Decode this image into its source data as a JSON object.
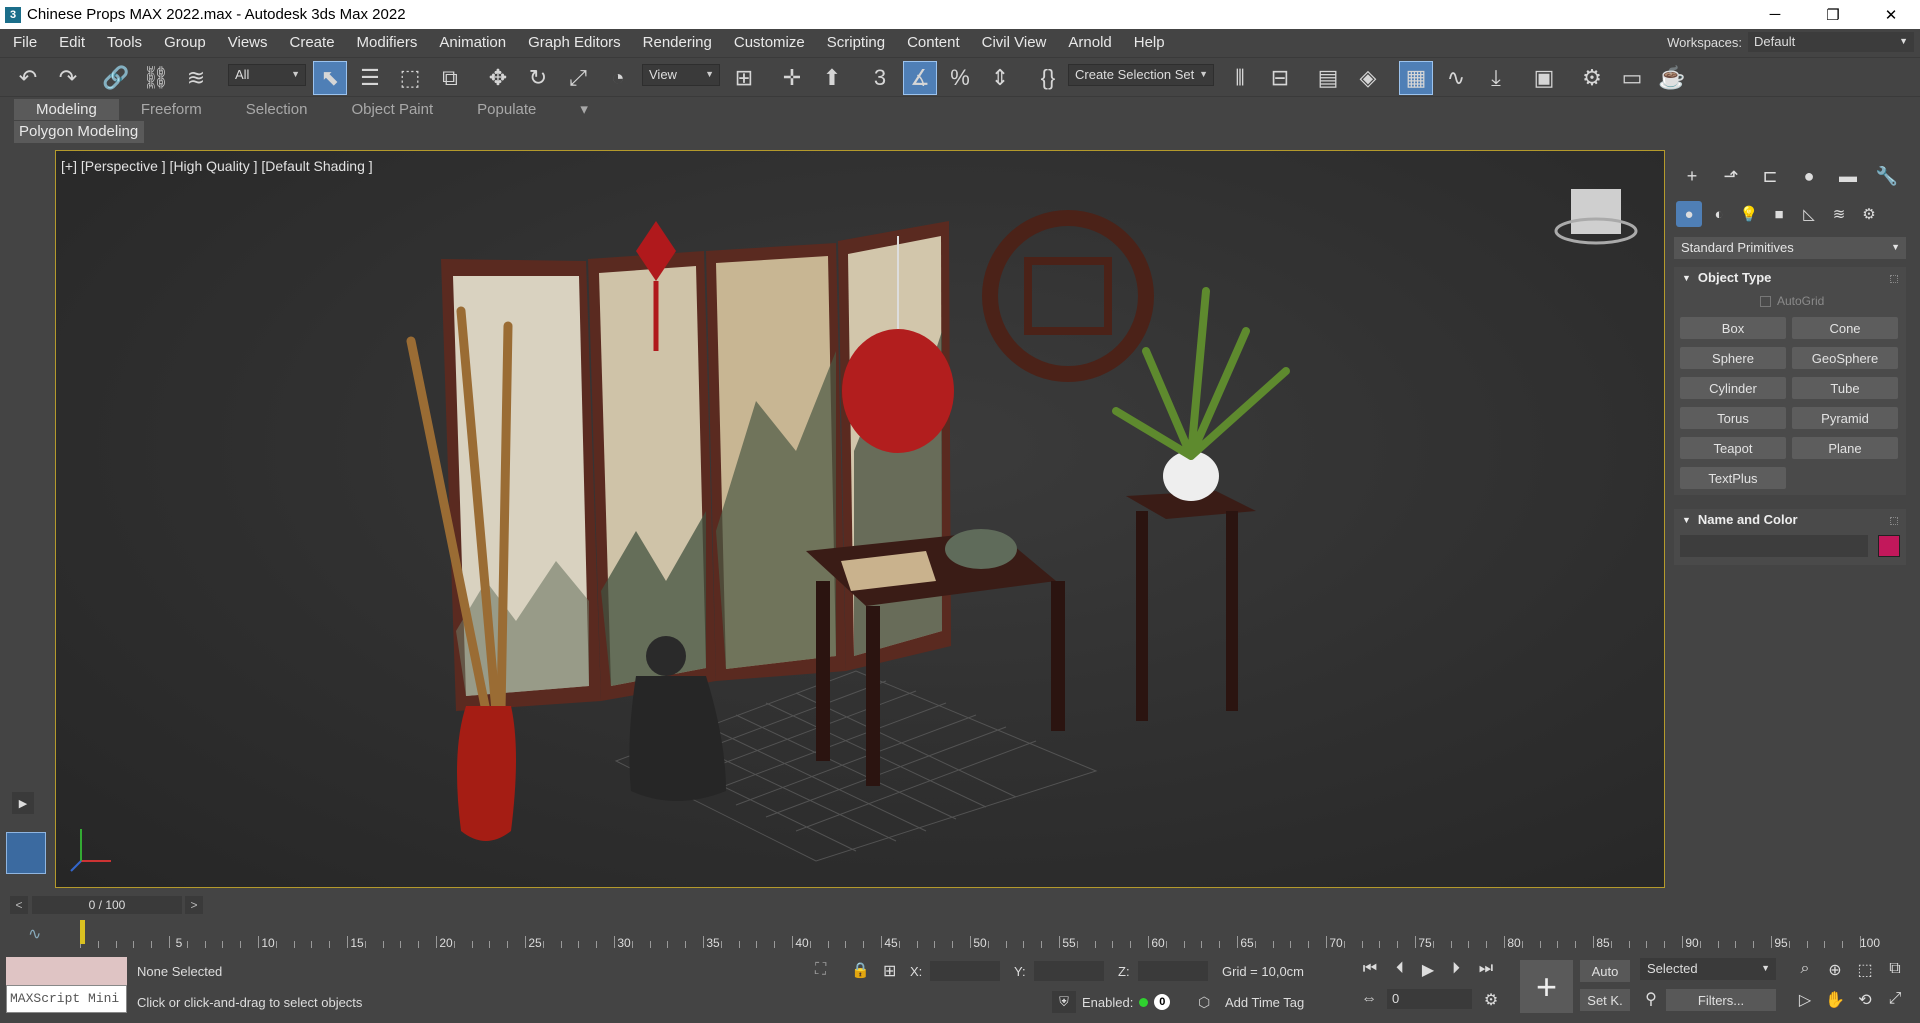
{
  "window": {
    "title": "Chinese Props MAX 2022.max - Autodesk 3ds Max 2022",
    "app_icon": "3",
    "minimize": "─",
    "maximize": "❐",
    "close": "✕"
  },
  "menu": [
    "File",
    "Edit",
    "Tools",
    "Group",
    "Views",
    "Create",
    "Modifiers",
    "Animation",
    "Graph Editors",
    "Rendering",
    "Customize",
    "Scripting",
    "Content",
    "Civil View",
    "Arnold",
    "Help"
  ],
  "workspace": {
    "label": "Workspaces:",
    "value": "Default"
  },
  "toolbar": {
    "selection_filter": "All",
    "ref_coord": "View",
    "named_selection": "Create Selection Set"
  },
  "ribbon": {
    "tabs": [
      "Modeling",
      "Freeform",
      "Selection",
      "Object Paint",
      "Populate"
    ],
    "panel": "Polygon Modeling"
  },
  "viewport": {
    "label": "[+] [Perspective ] [High Quality ] [Default Shading ]"
  },
  "command_panel": {
    "category": "Standard Primitives",
    "object_type_title": "Object Type",
    "autogrid": "AutoGrid",
    "primitives": [
      "Box",
      "Cone",
      "Sphere",
      "GeoSphere",
      "Cylinder",
      "Tube",
      "Torus",
      "Pyramid",
      "Teapot",
      "Plane",
      "TextPlus"
    ],
    "name_color_title": "Name and Color",
    "color": "#c2185b"
  },
  "time": {
    "frame": "0 / 100",
    "prev": "<",
    "next": ">"
  },
  "ruler": {
    "labels": [
      "5",
      "10",
      "15",
      "20",
      "25",
      "30",
      "35",
      "40",
      "45",
      "50",
      "55",
      "60",
      "65",
      "70",
      "75",
      "80",
      "85",
      "90",
      "95",
      "100"
    ]
  },
  "status": {
    "maxscript": "MAXScript Mini",
    "selection": "None Selected",
    "prompt": "Click or click-and-drag to select objects",
    "x_label": "X:",
    "y_label": "Y:",
    "z_label": "Z:",
    "grid": "Grid = 10,0cm",
    "enabled": "Enabled:",
    "zero": "0",
    "add_time_tag": "Add Time Tag",
    "auto": "Auto",
    "set_key": "Set K.",
    "key_filter": "Selected",
    "filters": "Filters...",
    "frame": "0"
  }
}
